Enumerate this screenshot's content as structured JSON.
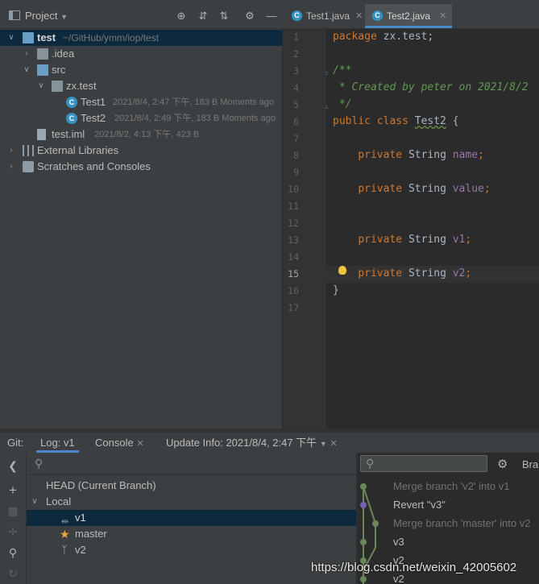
{
  "project_panel": {
    "title": "Project",
    "tree": [
      {
        "label": "test",
        "meta": "~/GitHub/ymm/iop/test",
        "type": "module",
        "expanded": true
      },
      {
        "label": ".idea",
        "meta": "",
        "type": "folder",
        "expanded": false
      },
      {
        "label": "src",
        "meta": "",
        "type": "source-folder",
        "expanded": true
      },
      {
        "label": "zx.test",
        "meta": "",
        "type": "package",
        "expanded": true
      },
      {
        "label": "Test1",
        "meta": "2021/8/4, 2:47 下午, 183 B Moments ago",
        "type": "class"
      },
      {
        "label": "Test2",
        "meta": "2021/8/4, 2:49 下午, 183 B Moments ago",
        "type": "class"
      },
      {
        "label": "test.iml",
        "meta": "2021/8/2, 4:13 下午, 423 B",
        "type": "file"
      },
      {
        "label": "External Libraries",
        "meta": "",
        "type": "libraries",
        "expanded": false
      },
      {
        "label": "Scratches and Consoles",
        "meta": "",
        "type": "scratches",
        "expanded": false
      }
    ]
  },
  "editor": {
    "tabs": [
      {
        "label": "Test1.java",
        "active": false
      },
      {
        "label": "Test2.java",
        "active": true
      }
    ],
    "current_line": 15,
    "line_numbers": [
      "1",
      "2",
      "3",
      "4",
      "5",
      "6",
      "7",
      "8",
      "9",
      "10",
      "11",
      "12",
      "13",
      "14",
      "15",
      "16",
      "17"
    ],
    "code": {
      "l1_kw": "package",
      "l1_rest": " zx.test;",
      "l4": "/**",
      "l5": " * Created by peter on 2021/8/2",
      "l6": " */",
      "l7_kw": "public class",
      "l7_name": "Test2",
      "l7_rest": " {",
      "private_kw": "private",
      "type": "String",
      "field1": "name",
      "field2": "value",
      "field3": "v1",
      "field4": "v2",
      "semi": ";",
      "close": "}"
    }
  },
  "git": {
    "label": "Git:",
    "tabs": [
      {
        "label": "Log: v1",
        "active": true
      },
      {
        "label": "Console",
        "active": false
      },
      {
        "label": "Update Info: 2021/8/4, 2:47 下午",
        "active": false
      }
    ],
    "branches": {
      "head": "HEAD (Current Branch)",
      "local_label": "Local",
      "items": [
        {
          "label": "v1",
          "icon": "tag-icon",
          "selected": true
        },
        {
          "label": "master",
          "icon": "star-icon",
          "selected": false
        },
        {
          "label": "v2",
          "icon": "branch-icon",
          "selected": false
        }
      ]
    },
    "log_toolbar_label": "Bra",
    "log": [
      {
        "message": "Merge branch 'v2' into v1",
        "dim": true,
        "dot_color": "#6a8759"
      },
      {
        "message": "Revert \"v3\"",
        "dim": false,
        "dot_color": "#7a5fb4"
      },
      {
        "message": "Merge branch 'master' into v2",
        "dim": true,
        "dot_color": "#6a8759"
      },
      {
        "message": "v3",
        "dim": false,
        "dot_color": "#6a8759"
      },
      {
        "message": "v2",
        "dim": false,
        "dot_color": "#6a8759"
      },
      {
        "message": "v2",
        "dim": false,
        "dot_color": "#6a8759"
      }
    ]
  },
  "watermark": "https://blog.csdn.net/weixin_42005602",
  "colors": {
    "accent": "#4a88c7",
    "selection": "#0d293e",
    "keyword": "#cc7832",
    "comment": "#629755"
  }
}
